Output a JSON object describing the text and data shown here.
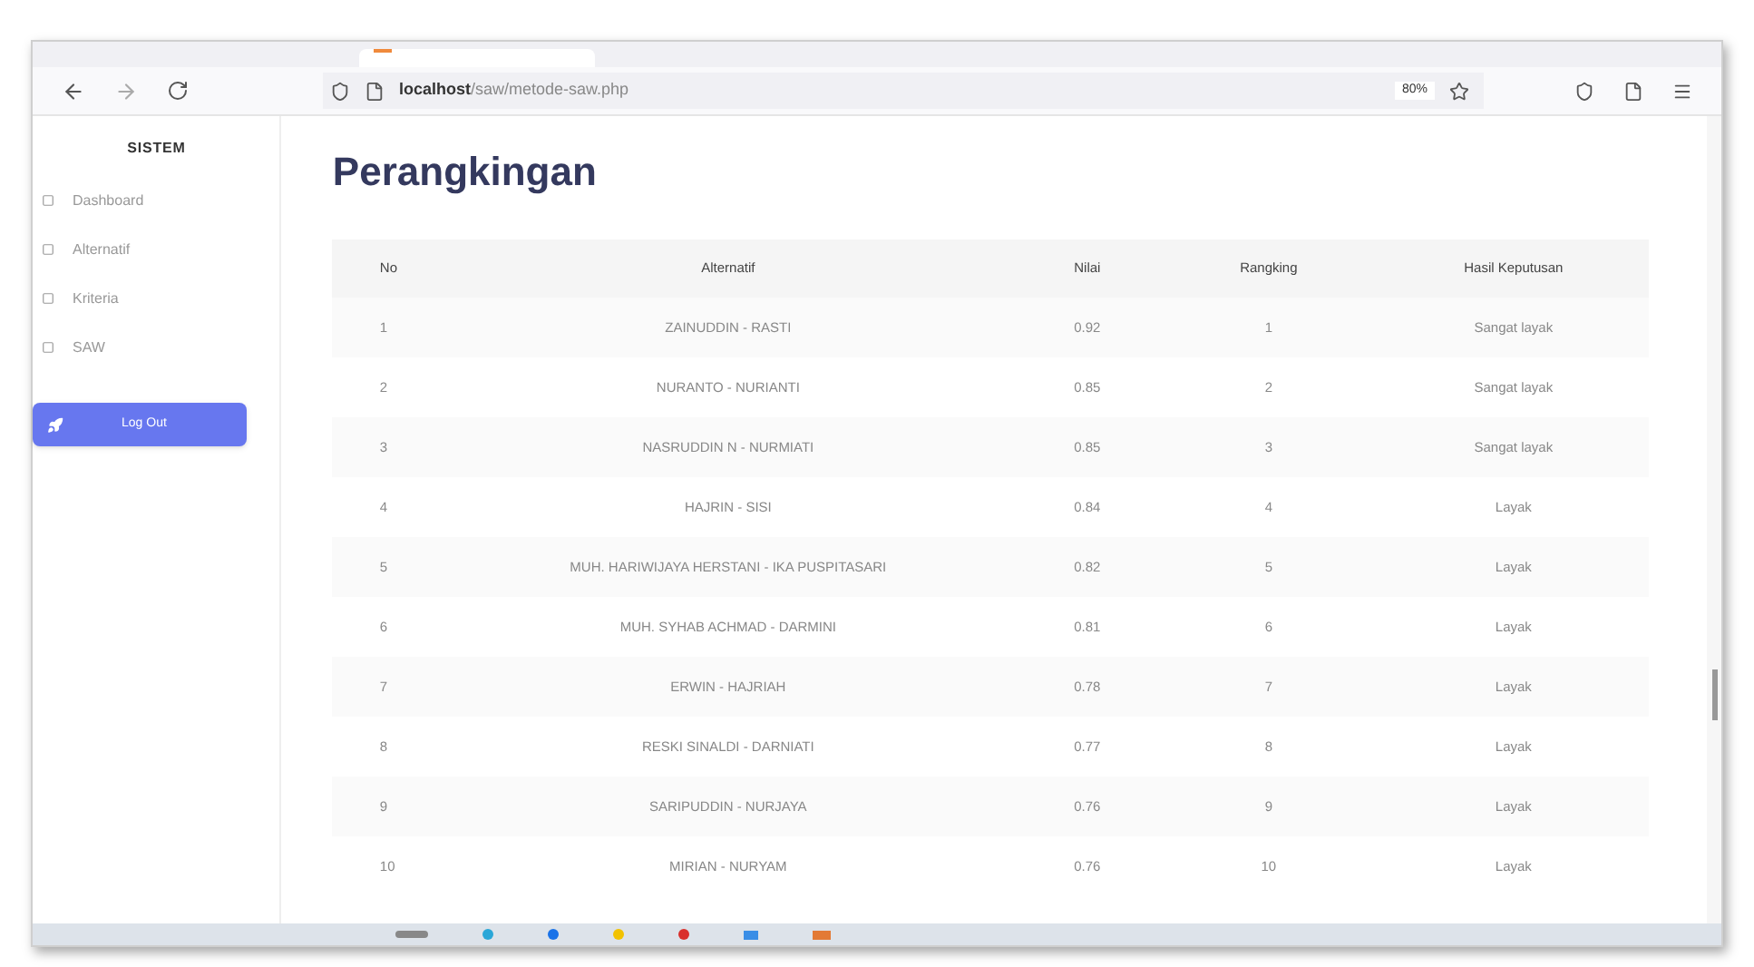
{
  "browser": {
    "url_host": "localhost",
    "url_path": "/saw/metode-saw.php",
    "zoom": "80%"
  },
  "sidebar": {
    "title": "SISTEM",
    "items": [
      {
        "label": "Dashboard"
      },
      {
        "label": "Alternatif"
      },
      {
        "label": "Kriteria"
      },
      {
        "label": "SAW"
      }
    ],
    "logout": "Log Out"
  },
  "page_title": "Perangkingan",
  "table": {
    "columns": [
      "No",
      "Alternatif",
      "Nilai",
      "Rangking",
      "Hasil Keputusan"
    ],
    "rows": [
      [
        "1",
        "ZAINUDDIN - RASTI",
        "0.92",
        "1",
        "Sangat layak"
      ],
      [
        "2",
        "NURANTO - NURIANTI",
        "0.85",
        "2",
        "Sangat layak"
      ],
      [
        "3",
        "NASRUDDIN N - NURMIATI",
        "0.85",
        "3",
        "Sangat layak"
      ],
      [
        "4",
        "HAJRIN - SISI",
        "0.84",
        "4",
        "Layak"
      ],
      [
        "5",
        "MUH. HARIWIJAYA HERSTANI - IKA PUSPITASARI",
        "0.82",
        "5",
        "Layak"
      ],
      [
        "6",
        "MUH. SYHAB ACHMAD - DARMINI",
        "0.81",
        "6",
        "Layak"
      ],
      [
        "7",
        "ERWIN - HAJRIAH",
        "0.78",
        "7",
        "Layak"
      ],
      [
        "8",
        "RESKI SINALDI - DARNIATI",
        "0.77",
        "8",
        "Layak"
      ],
      [
        "9",
        "SARIPUDDIN - NURJAYA",
        "0.76",
        "9",
        "Layak"
      ],
      [
        "10",
        "MIRIAN - NURYAM",
        "0.76",
        "10",
        "Layak"
      ]
    ]
  }
}
